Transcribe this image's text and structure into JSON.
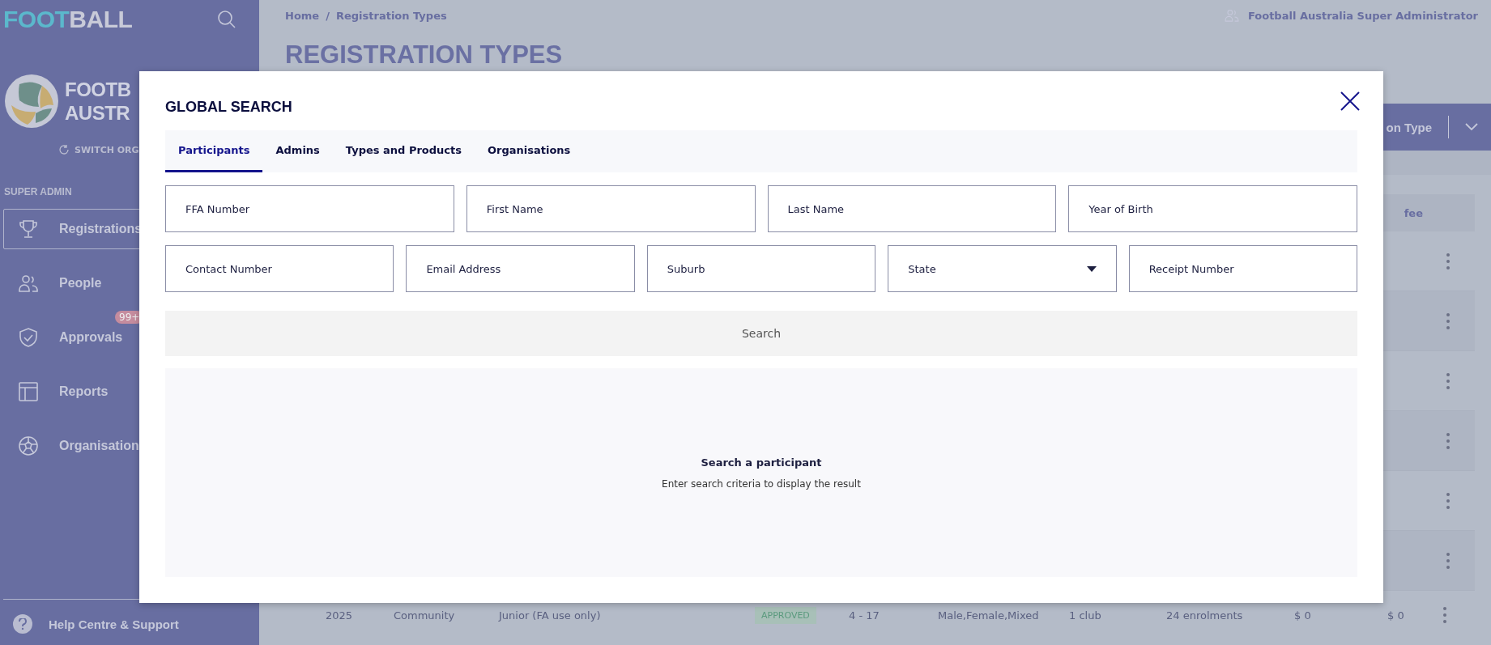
{
  "sidebar": {
    "logo_parts": [
      "FOOT",
      "BALL"
    ],
    "org_name_lines": [
      "FOOTB",
      "AUSTR"
    ],
    "switch_label": "SWITCH ORG",
    "section_label": "SUPER ADMIN",
    "items": [
      {
        "label": "Registrations",
        "kind": "trophy",
        "selected": true
      },
      {
        "label": "People",
        "kind": "people",
        "selected": false
      },
      {
        "label": "Approvals",
        "kind": "shield",
        "selected": false,
        "badge": "99+"
      },
      {
        "label": "Reports",
        "kind": "layout",
        "selected": false
      },
      {
        "label": "Organisation",
        "kind": "ball",
        "selected": false
      }
    ],
    "help": "Help Centre & Support"
  },
  "header": {
    "breadcrumb": [
      "Home",
      "/",
      "Registration Types"
    ],
    "user": "Football Australia Super Administrator",
    "title": "REGISTRATION TYPES",
    "action_button": "on Type"
  },
  "table": {
    "column_header": "fee",
    "rows": [
      {
        "cells": [
          "2025",
          "Community",
          "Junior (FA use only)",
          "APPROVED",
          "4 - 17",
          "Male,Female,Mixed",
          "1 club",
          "24 enrolments",
          "$ 0",
          "$ 0"
        ]
      }
    ]
  },
  "modal": {
    "title": "GLOBAL SEARCH",
    "tabs": [
      {
        "label": "Participants",
        "selected": true
      },
      {
        "label": "Admins",
        "selected": false
      },
      {
        "label": "Types and Products",
        "selected": false
      },
      {
        "label": "Organisations",
        "selected": false
      }
    ],
    "field_rows": [
      [
        {
          "kind": "text",
          "placeholder": "FFA Number"
        },
        {
          "kind": "text",
          "placeholder": "First Name"
        },
        {
          "kind": "text",
          "placeholder": "Last Name"
        },
        {
          "kind": "text",
          "placeholder": "Year of Birth"
        }
      ],
      [
        {
          "kind": "text",
          "placeholder": "Contact Number"
        },
        {
          "kind": "text",
          "placeholder": "Email Address"
        },
        {
          "kind": "text",
          "placeholder": "Suburb"
        },
        {
          "kind": "select",
          "placeholder": "State"
        },
        {
          "kind": "text",
          "placeholder": "Receipt Number"
        }
      ]
    ],
    "search_button": "Search",
    "empty_title": "Search a participant",
    "empty_text": "Enter search criteria to display the result"
  }
}
